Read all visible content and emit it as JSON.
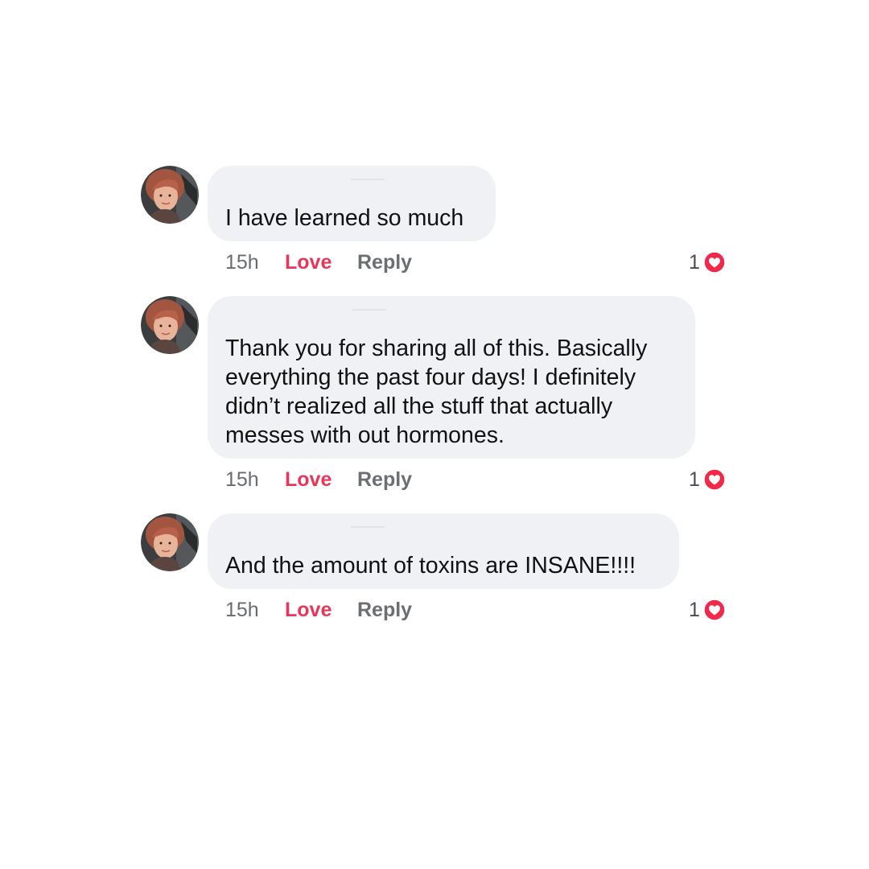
{
  "comments": [
    {
      "text": "I have learned so much",
      "time": "15h",
      "love_label": "Love",
      "reply_label": "Reply",
      "reaction_count": "1",
      "reaction_icon": "heart-icon"
    },
    {
      "text": "Thank you for sharing all of this. Basically\neverything the past four days! I definitely\ndidn’t realized all the stuff that actually\nmesses with out hormones.",
      "time": "15h",
      "love_label": "Love",
      "reply_label": "Reply",
      "reaction_count": "1",
      "reaction_icon": "heart-icon"
    },
    {
      "text": "And the amount of toxins are INSANE!!!!",
      "time": "15h",
      "love_label": "Love",
      "reply_label": "Reply",
      "reaction_count": "1",
      "reaction_icon": "heart-icon"
    }
  ],
  "colors": {
    "bubble": "#f0f1f4",
    "love": "#e8365b",
    "heart": "#f0284a",
    "muted": "#686b70"
  }
}
